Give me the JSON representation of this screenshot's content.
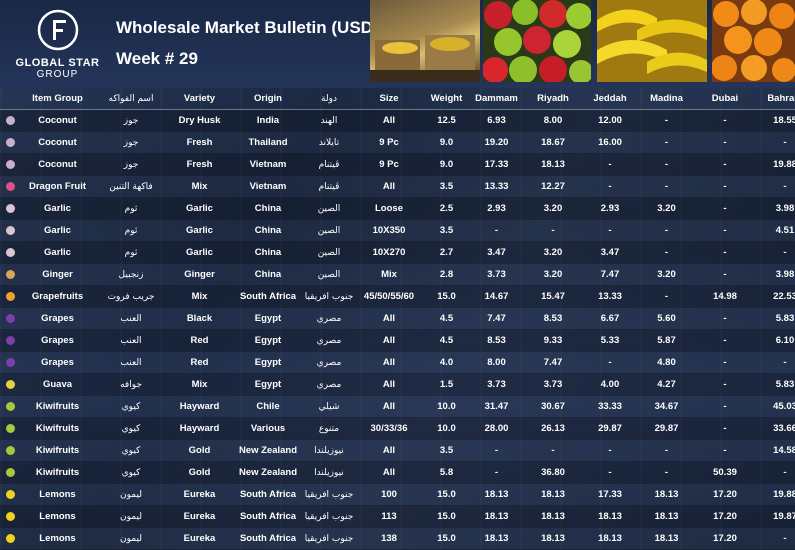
{
  "header": {
    "logo_line1": "GLOBAL STAR",
    "logo_line2": "GROUP",
    "title": "Wholesale Market Bulletin (USD)",
    "week": "Week # 29"
  },
  "columns": [
    "",
    "Item Group",
    "اسم الفواكه",
    "Variety",
    "Origin",
    "دولة",
    "Size",
    "Weight",
    "Dammam",
    "Riyadh",
    "Jeddah",
    "Madina",
    "Dubai",
    "Bahrain"
  ],
  "rows": [
    {
      "icon": "coconut-icon",
      "color": "#c9b0c9",
      "item": "Coconut",
      "ar": "جوز",
      "variety": "Dry Husk",
      "origin": "India",
      "country_ar": "الهند",
      "size": "All",
      "weight": "12.5",
      "dammam": "6.93",
      "riyadh": "8.00",
      "jeddah": "12.00",
      "madina": "-",
      "dubai": "-",
      "bahrain": "18.55"
    },
    {
      "icon": "coconut-icon",
      "color": "#c9b0c9",
      "item": "Coconut",
      "ar": "جوز",
      "variety": "Fresh",
      "origin": "Thailand",
      "country_ar": "تايلاند",
      "size": "9 Pc",
      "weight": "9.0",
      "dammam": "19.20",
      "riyadh": "18.67",
      "jeddah": "16.00",
      "madina": "-",
      "dubai": "-",
      "bahrain": "-"
    },
    {
      "icon": "coconut-icon",
      "color": "#c9b0c9",
      "item": "Coconut",
      "ar": "جوز",
      "variety": "Fresh",
      "origin": "Vietnam",
      "country_ar": "ڤيتنام",
      "size": "9 Pc",
      "weight": "9.0",
      "dammam": "17.33",
      "riyadh": "18.13",
      "jeddah": "-",
      "madina": "-",
      "dubai": "-",
      "bahrain": "19.88"
    },
    {
      "icon": "dragon-fruit-icon",
      "color": "#e0508a",
      "item": "Dragon Fruit",
      "ar": "فاكهة التنين",
      "variety": "Mix",
      "origin": "Vietnam",
      "country_ar": "ڤيتنام",
      "size": "All",
      "weight": "3.5",
      "dammam": "13.33",
      "riyadh": "12.27",
      "jeddah": "-",
      "madina": "-",
      "dubai": "-",
      "bahrain": "-"
    },
    {
      "icon": "garlic-icon",
      "color": "#d9c4cf",
      "item": "Garlic",
      "ar": "ثوم",
      "variety": "Garlic",
      "origin": "China",
      "country_ar": "الصين",
      "size": "Loose",
      "weight": "2.5",
      "dammam": "2.93",
      "riyadh": "3.20",
      "jeddah": "2.93",
      "madina": "3.20",
      "dubai": "-",
      "bahrain": "3.98"
    },
    {
      "icon": "garlic-icon",
      "color": "#d9c4cf",
      "item": "Garlic",
      "ar": "ثوم",
      "variety": "Garlic",
      "origin": "China",
      "country_ar": "الصين",
      "size": "10X350",
      "weight": "3.5",
      "dammam": "-",
      "riyadh": "-",
      "jeddah": "-",
      "madina": "-",
      "dubai": "-",
      "bahrain": "4.51"
    },
    {
      "icon": "garlic-icon",
      "color": "#d9c4cf",
      "item": "Garlic",
      "ar": "ثوم",
      "variety": "Garlic",
      "origin": "China",
      "country_ar": "الصين",
      "size": "10X270",
      "weight": "2.7",
      "dammam": "3.47",
      "riyadh": "3.20",
      "jeddah": "3.47",
      "madina": "-",
      "dubai": "-",
      "bahrain": "-"
    },
    {
      "icon": "ginger-icon",
      "color": "#d9a35a",
      "item": "Ginger",
      "ar": "زنجبيل",
      "variety": "Ginger",
      "origin": "China",
      "country_ar": "الصين",
      "size": "Mix",
      "weight": "2.8",
      "dammam": "3.73",
      "riyadh": "3.20",
      "jeddah": "7.47",
      "madina": "3.20",
      "dubai": "-",
      "bahrain": "3.98"
    },
    {
      "icon": "grapefruit-icon",
      "color": "#f0a030",
      "item": "Grapefruits",
      "ar": "جريب فروت",
      "variety": "Mix",
      "origin": "South Africa",
      "country_ar": "جنوب افريقيا",
      "size": "45/50/55/60",
      "weight": "15.0",
      "dammam": "14.67",
      "riyadh": "15.47",
      "jeddah": "13.33",
      "madina": "-",
      "dubai": "14.98",
      "bahrain": "22.53"
    },
    {
      "icon": "grapes-icon",
      "color": "#7b3fa8",
      "item": "Grapes",
      "ar": "العنب",
      "variety": "Black",
      "origin": "Egypt",
      "country_ar": "مصري",
      "size": "All",
      "weight": "4.5",
      "dammam": "7.47",
      "riyadh": "8.53",
      "jeddah": "6.67",
      "madina": "5.60",
      "dubai": "-",
      "bahrain": "5.83"
    },
    {
      "icon": "grapes-icon",
      "color": "#7b3fa8",
      "item": "Grapes",
      "ar": "العنب",
      "variety": "Red",
      "origin": "Egypt",
      "country_ar": "مصري",
      "size": "All",
      "weight": "4.5",
      "dammam": "8.53",
      "riyadh": "9.33",
      "jeddah": "5.33",
      "madina": "5.87",
      "dubai": "-",
      "bahrain": "6.10"
    },
    {
      "icon": "grapes-icon",
      "color": "#7b3fa8",
      "item": "Grapes",
      "ar": "العنب",
      "variety": "Red",
      "origin": "Egypt",
      "country_ar": "مصري",
      "size": "All",
      "weight": "4.0",
      "dammam": "8.00",
      "riyadh": "7.47",
      "jeddah": "-",
      "madina": "4.80",
      "dubai": "-",
      "bahrain": "-"
    },
    {
      "icon": "guava-icon",
      "color": "#e6d23a",
      "item": "Guava",
      "ar": "جوافه",
      "variety": "Mix",
      "origin": "Egypt",
      "country_ar": "مصري",
      "size": "All",
      "weight": "1.5",
      "dammam": "3.73",
      "riyadh": "3.73",
      "jeddah": "4.00",
      "madina": "4.27",
      "dubai": "-",
      "bahrain": "5.83"
    },
    {
      "icon": "kiwi-icon",
      "color": "#a7c83a",
      "item": "Kiwifruits",
      "ar": "كيوي",
      "variety": "Hayward",
      "origin": "Chile",
      "country_ar": "شيلي",
      "size": "All",
      "weight": "10.0",
      "dammam": "31.47",
      "riyadh": "30.67",
      "jeddah": "33.33",
      "madina": "34.67",
      "dubai": "-",
      "bahrain": "45.03"
    },
    {
      "icon": "kiwi-icon",
      "color": "#a7c83a",
      "item": "Kiwifruits",
      "ar": "كيوي",
      "variety": "Hayward",
      "origin": "Various",
      "country_ar": "متنوع",
      "size": "30/33/36",
      "weight": "10.0",
      "dammam": "28.00",
      "riyadh": "26.13",
      "jeddah": "29.87",
      "madina": "29.87",
      "dubai": "-",
      "bahrain": "33.66"
    },
    {
      "icon": "kiwi-icon",
      "color": "#a7c83a",
      "item": "Kiwifruits",
      "ar": "كيوي",
      "variety": "Gold",
      "origin": "New Zealand",
      "country_ar": "نيوزيلندا",
      "size": "All",
      "weight": "3.5",
      "dammam": "-",
      "riyadh": "-",
      "jeddah": "-",
      "madina": "-",
      "dubai": "-",
      "bahrain": "14.58"
    },
    {
      "icon": "kiwi-icon",
      "color": "#a7c83a",
      "item": "Kiwifruits",
      "ar": "كيوي",
      "variety": "Gold",
      "origin": "New Zealand",
      "country_ar": "نيوزيلندا",
      "size": "All",
      "weight": "5.8",
      "dammam": "-",
      "riyadh": "36.80",
      "jeddah": "-",
      "madina": "-",
      "dubai": "50.39",
      "bahrain": "-"
    },
    {
      "icon": "lemon-icon",
      "color": "#f2d21a",
      "item": "Lemons",
      "ar": "ليمون",
      "variety": "Eureka",
      "origin": "South Africa",
      "country_ar": "جنوب افريقيا",
      "size": "100",
      "weight": "15.0",
      "dammam": "18.13",
      "riyadh": "18.13",
      "jeddah": "17.33",
      "madina": "18.13",
      "dubai": "17.20",
      "bahrain": "19.88"
    },
    {
      "icon": "lemon-icon",
      "color": "#f2d21a",
      "item": "Lemons",
      "ar": "ليمون",
      "variety": "Eureka",
      "origin": "South Africa",
      "country_ar": "جنوب افريقيا",
      "size": "113",
      "weight": "15.0",
      "dammam": "18.13",
      "riyadh": "18.13",
      "jeddah": "18.13",
      "madina": "18.13",
      "dubai": "17.20",
      "bahrain": "19.87"
    },
    {
      "icon": "lemon-icon",
      "color": "#f2d21a",
      "item": "Lemons",
      "ar": "ليمون",
      "variety": "Eureka",
      "origin": "South Africa",
      "country_ar": "جنوب افريقيا",
      "size": "138",
      "weight": "15.0",
      "dammam": "18.13",
      "riyadh": "18.13",
      "jeddah": "18.13",
      "madina": "18.13",
      "dubai": "17.20",
      "bahrain": "-"
    }
  ]
}
